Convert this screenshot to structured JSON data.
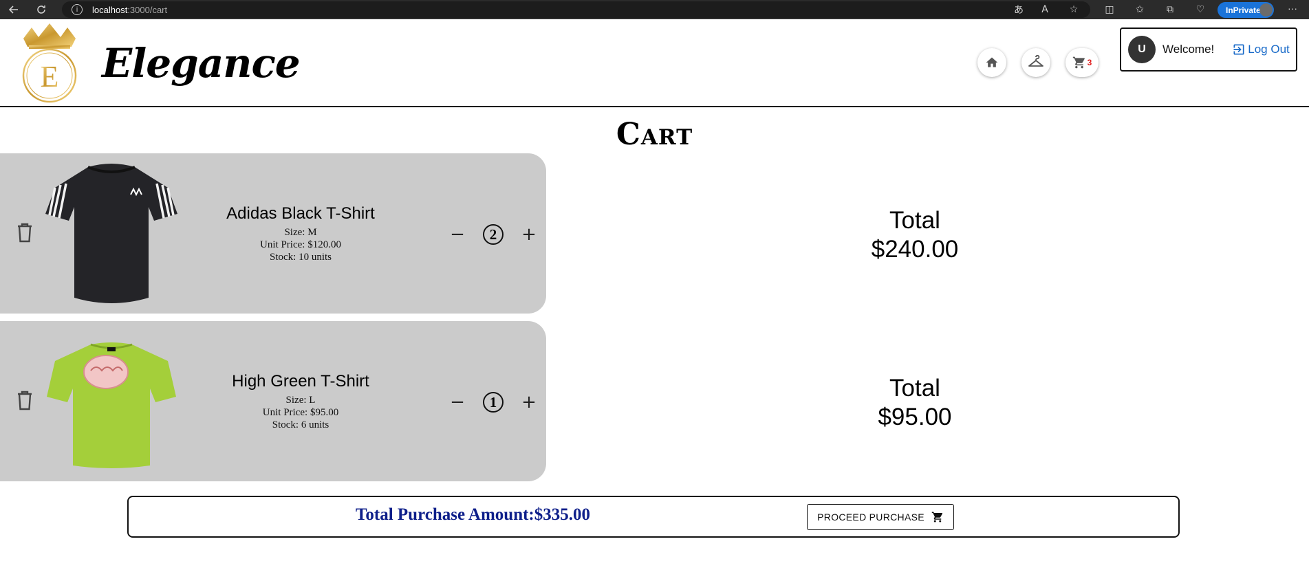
{
  "browser": {
    "url_host": "localhost",
    "url_path": ":3000/cart",
    "inprivate_label": "InPrivate"
  },
  "header": {
    "logo_letter": "E",
    "brand": "Elegance",
    "cart_count": "3",
    "user": {
      "avatar_letter": "U",
      "welcome": "Welcome!",
      "logout_label": "Log Out"
    }
  },
  "page": {
    "title": "Cart"
  },
  "cart": {
    "items": [
      {
        "name": "Adidas Black T-Shirt",
        "size": "Size: M",
        "unit_price": "Unit Price: $120.00",
        "stock": "Stock: 10 units",
        "quantity": "2",
        "total_label": "Total",
        "total": "$240.00",
        "shirt_color": "#242428"
      },
      {
        "name": "High Green T-Shirt",
        "size": "Size: L",
        "unit_price": "Unit Price: $95.00",
        "stock": "Stock: 6 units",
        "quantity": "1",
        "total_label": "Total",
        "total": "$95.00",
        "shirt_color": "#a4cf3a"
      }
    ],
    "summary_label": "Total Purchase Amount:$335.00",
    "proceed_label": "PROCEED PURCHASE"
  },
  "colors": {
    "card_bg": "#cbcbcb",
    "summary_text": "#0e1f8a",
    "link": "#1769c8",
    "cart_badge": "#e01f1f",
    "inprivate": "#1a73d9"
  }
}
